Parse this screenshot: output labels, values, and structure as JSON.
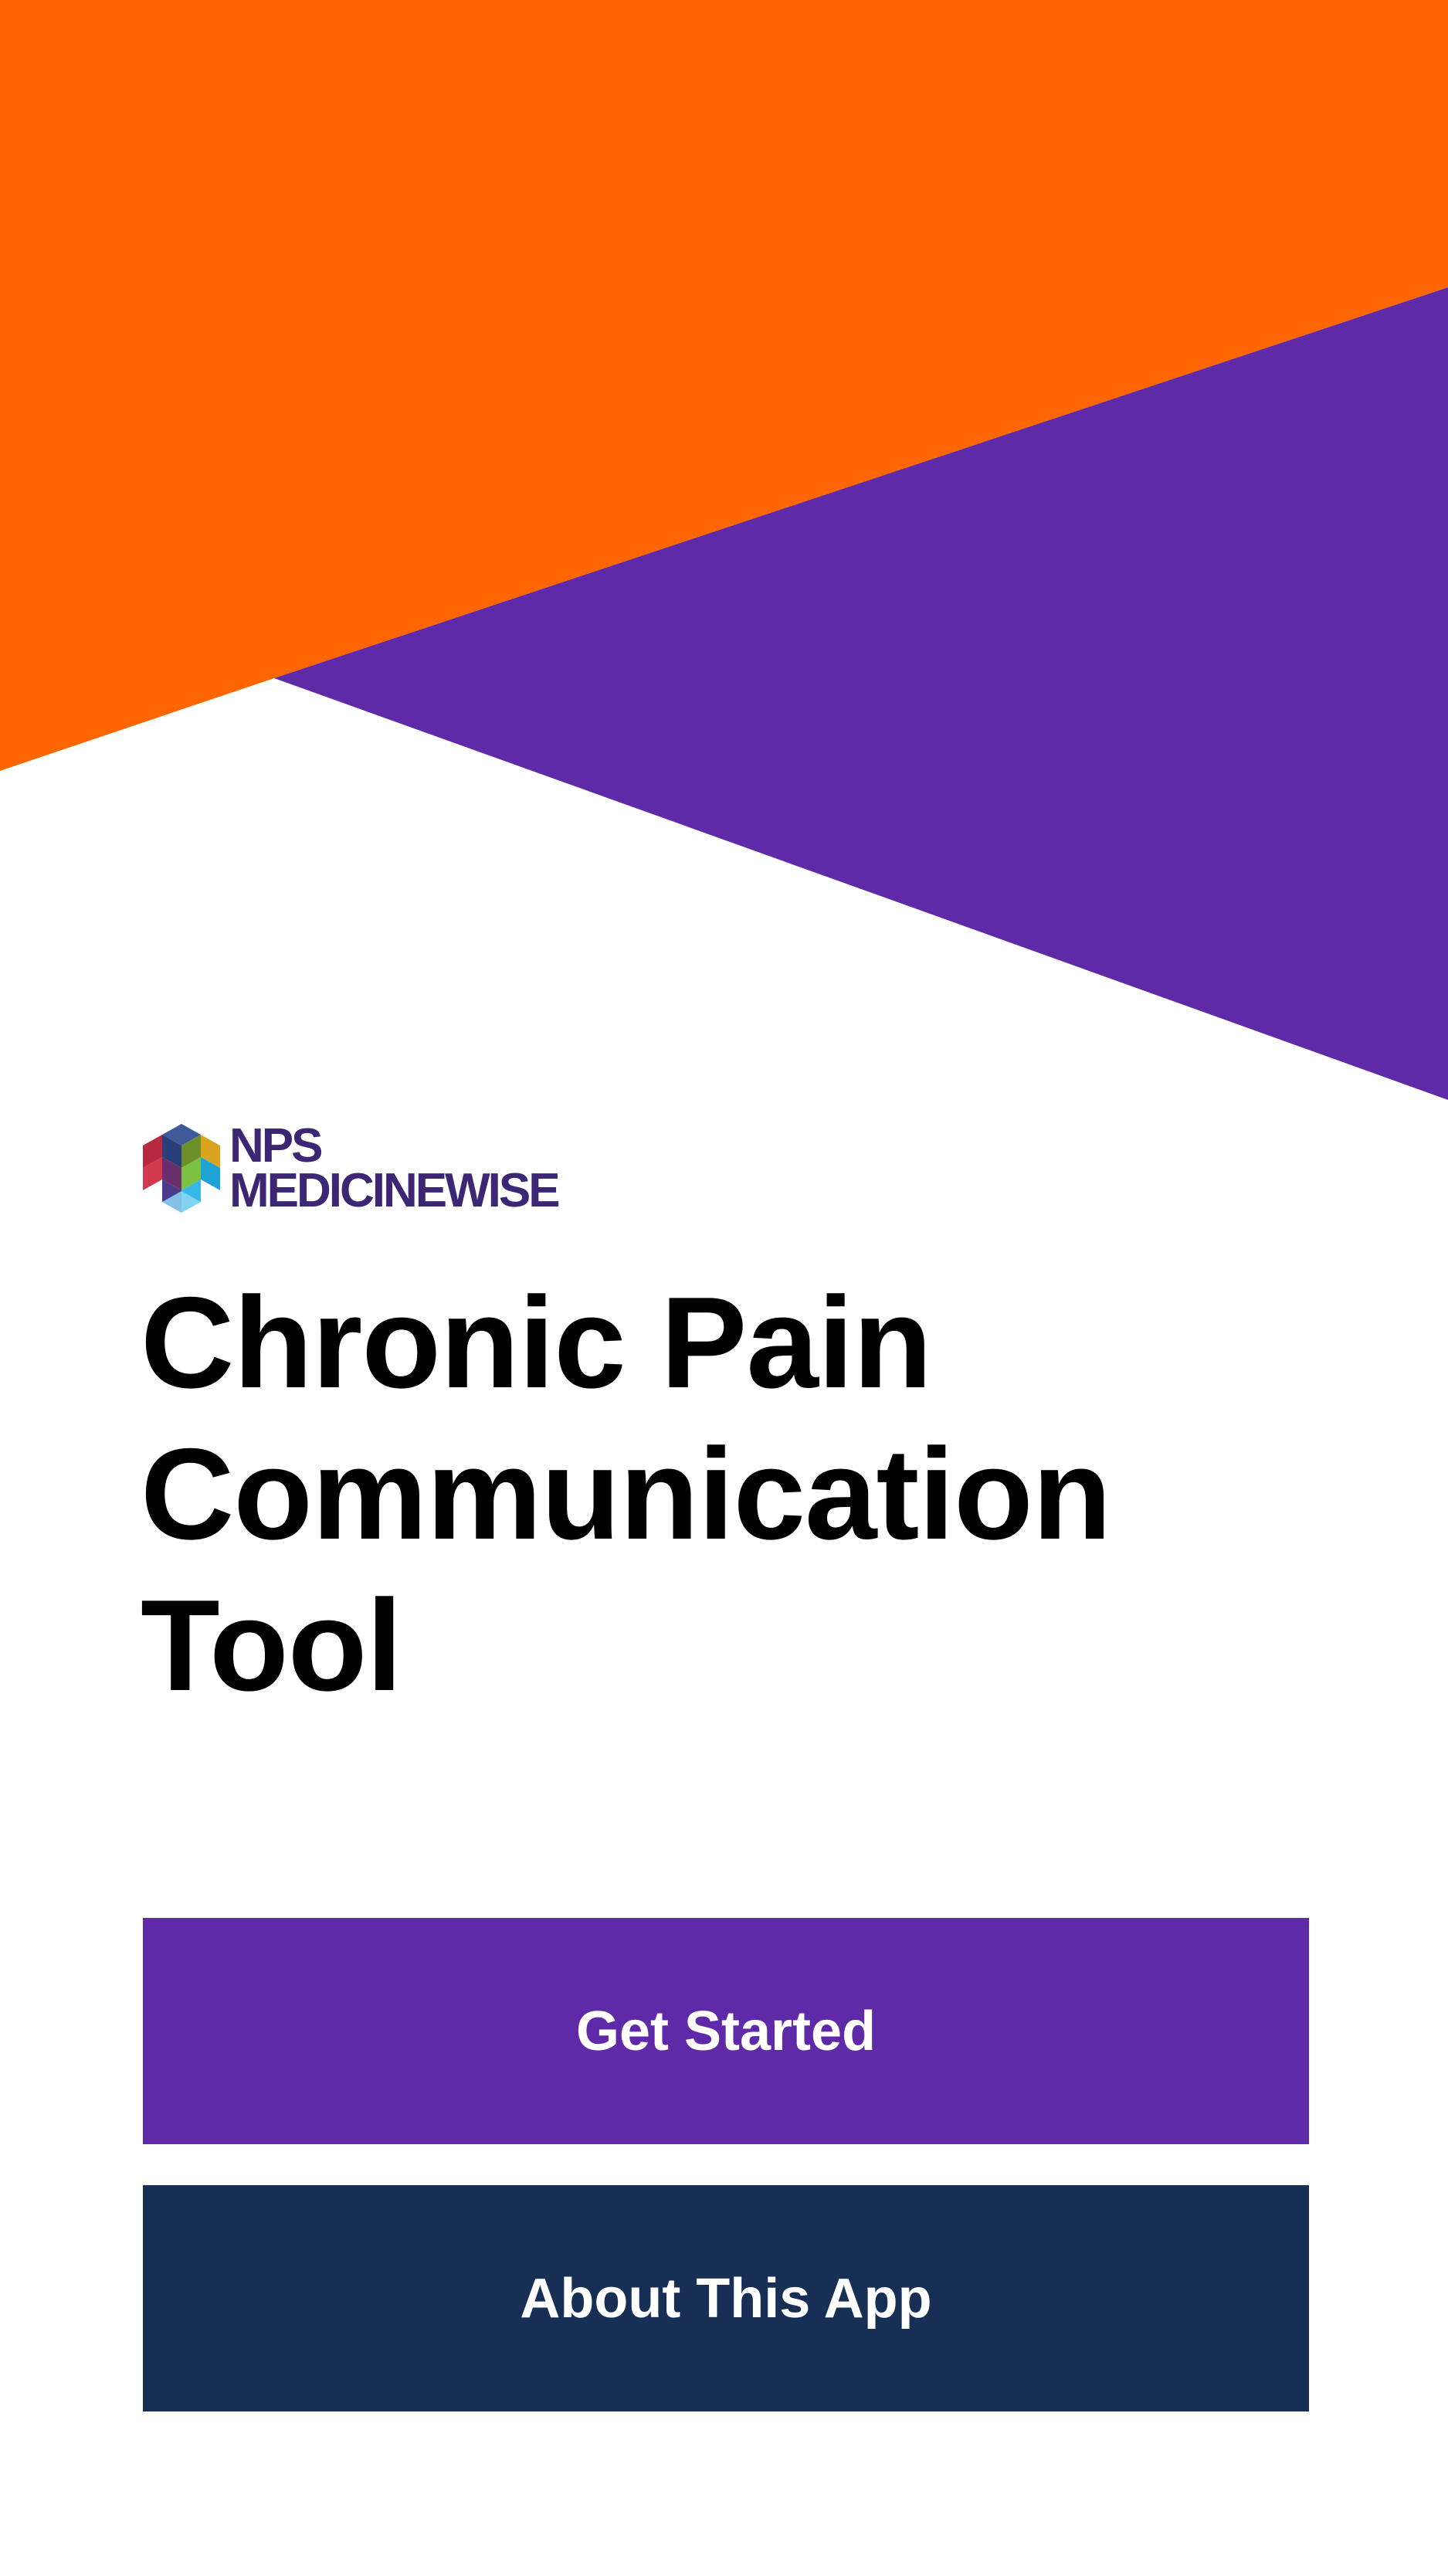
{
  "app": {
    "title": "Chronic Pain Communication Tool",
    "title_lines": [
      "Chronic Pain",
      "Communication",
      "Tool"
    ]
  },
  "logo": {
    "line1": "NPS",
    "line2": "MEDICINEWISE",
    "icon": "hexagon-cube-logo-icon"
  },
  "buttons": {
    "get_started": "Get Started",
    "about": "About This App"
  },
  "colors": {
    "orange": "#FF6600",
    "purple": "#5F2AA8",
    "navy": "#172F55",
    "logo_text": "#3D2673",
    "background": "#FFFFFF"
  }
}
